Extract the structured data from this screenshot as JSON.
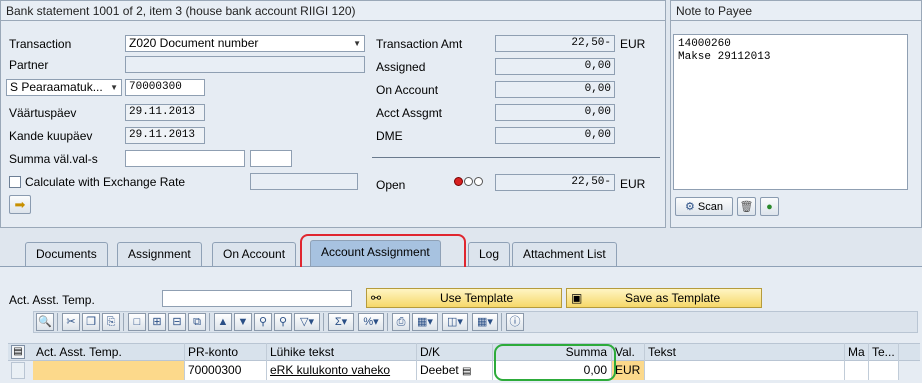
{
  "header": {
    "title": "Bank statement 1001 of 2, item 3 (house bank account RIIGI 120)"
  },
  "left": {
    "transaction_label": "Transaction",
    "transaction_value": "Z020 Document number",
    "partner_label": "Partner",
    "partner_value": "",
    "partner_type_value": "S Pearaamatuk...",
    "partner_type_number": "70000300",
    "value_date_label": "Väärtuspäev",
    "value_date": "29.11.2013",
    "posting_date_label": "Kande kuupäev",
    "posting_date": "29.11.2013",
    "fc_amount_label": "Summa väl.val-s",
    "fc_amount": "",
    "fc_currency": "",
    "exchange_rate_label": "Calculate with Exchange Rate",
    "exchange_rate_value": ""
  },
  "mid": {
    "transaction_amt_label": "Transaction Amt",
    "transaction_amt": "22,50-",
    "transaction_amt_currency": "EUR",
    "assigned_label": "Assigned",
    "assigned": "0,00",
    "on_account_label": "On Account",
    "on_account": "0,00",
    "acct_assgmt_label": "Acct Assgmt",
    "acct_assgmt": "0,00",
    "dme_label": "DME",
    "dme": "0,00",
    "open_label": "Open",
    "open": "22,50-",
    "open_currency": "EUR"
  },
  "note": {
    "title": "Note to Payee",
    "line1": "14000260",
    "line2": "Makse 29112013",
    "scan_label": "Scan"
  },
  "tabs": [
    {
      "label": "Documents"
    },
    {
      "label": "Assignment"
    },
    {
      "label": "On Account"
    },
    {
      "label": "Account Assignment"
    },
    {
      "label": "Log"
    },
    {
      "label": "Attachment List"
    }
  ],
  "assign": {
    "template_label": "Act. Asst. Temp.",
    "template_value": "",
    "use_template_label": "Use Template",
    "save_template_label": "Save as Template"
  },
  "table": {
    "headers": [
      "Act. Asst. Temp.",
      "PR-konto",
      "Lühike tekst",
      "D/K",
      "Summa",
      "Val.",
      "Tekst",
      "Ma",
      "Te..."
    ],
    "row": {
      "template": "",
      "pr_konto": "70000300",
      "short_text": "eRK kulukonto vaheko",
      "dk": "Deebet",
      "summa": "0,00",
      "val": "EUR",
      "tekst": "",
      "ma": "",
      "te": ""
    }
  },
  "colors": {
    "highlight_red": "#e0262f",
    "highlight_green": "#2dab3a",
    "tab_active": "#a7c2e0",
    "yellow_row": "#fcd98b"
  }
}
